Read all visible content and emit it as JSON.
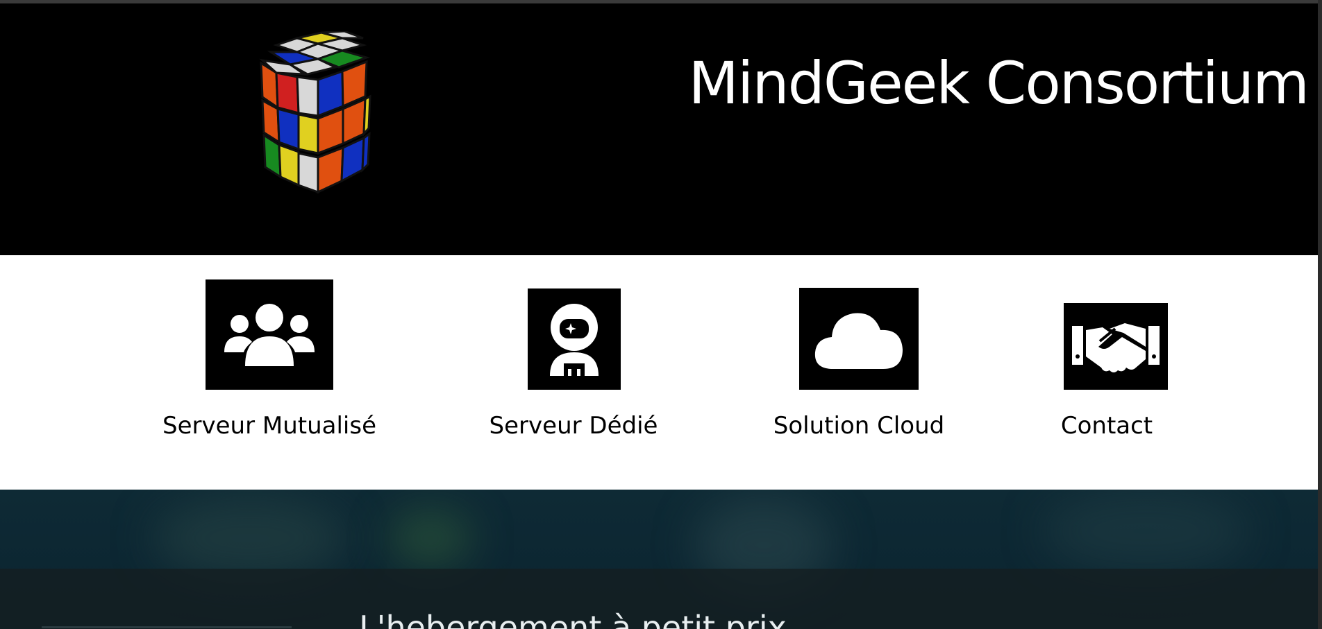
{
  "header": {
    "site_title": "MindGeek Consortium",
    "logo_icon": "rubiks-cube-icon"
  },
  "nav": {
    "items": [
      {
        "label": "Serveur Mutualisé",
        "icon": "users-group-icon"
      },
      {
        "label": "Serveur Dédié",
        "icon": "astronaut-icon"
      },
      {
        "label": "Solution Cloud",
        "icon": "cloud-icon"
      },
      {
        "label": "Contact",
        "icon": "handshake-icon"
      }
    ]
  },
  "hero": {
    "headline": "L'hebergement à petit prix"
  },
  "colors": {
    "header_bg": "#000000",
    "nav_bg": "#ffffff",
    "hero_bg": "#0e2a35",
    "text_light": "#ffffff"
  }
}
